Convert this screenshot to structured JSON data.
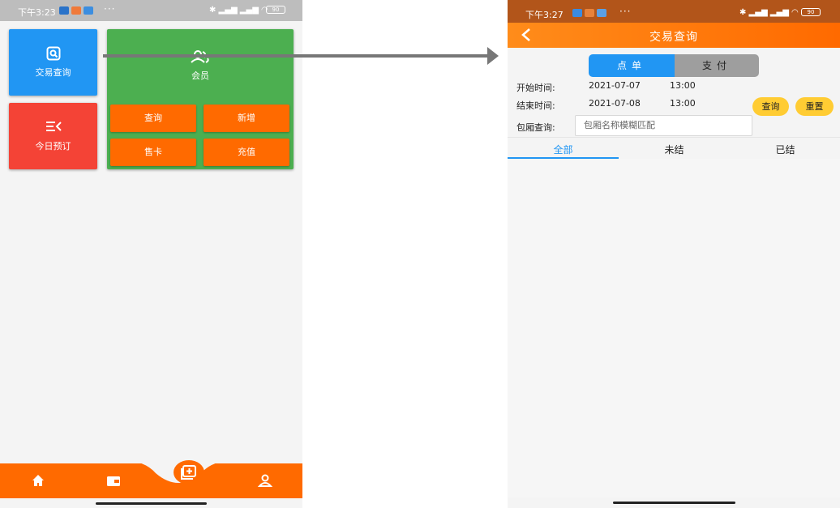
{
  "left_screen": {
    "status_bar": {
      "time": "下午3:23",
      "battery": "90"
    },
    "tiles": {
      "transaction_query": {
        "label": "交易查询",
        "color": "#2196f3"
      },
      "today_booking": {
        "label": "今日预订",
        "color": "#f44336"
      },
      "member": {
        "label": "会员",
        "color": "#4caf50",
        "buttons": [
          "查询",
          "新增",
          "售卡",
          "充值"
        ]
      }
    },
    "bottom_nav": {
      "color": "#ff6a00",
      "items": [
        "home-icon",
        "wallet-icon",
        "add-icon",
        "user-icon"
      ]
    }
  },
  "right_screen": {
    "status_bar": {
      "time": "下午3:27",
      "battery": "90"
    },
    "app_bar": {
      "title": "交易查询"
    },
    "segments": {
      "order": "点单",
      "payment": "支付",
      "active_color": "#2196f3"
    },
    "filters": {
      "start_label": "开始时间:",
      "start_date": "2021-07-07",
      "start_time": "13:00",
      "end_label": "结束时间:",
      "end_date": "2021-07-08",
      "end_time": "13:00",
      "query_button": "查询",
      "reset_button": "重置",
      "room_label": "包厢查询:",
      "room_placeholder": "包厢名称模糊匹配"
    },
    "tabs": [
      "全部",
      "未结",
      "已结"
    ],
    "active_tab": "全部"
  }
}
